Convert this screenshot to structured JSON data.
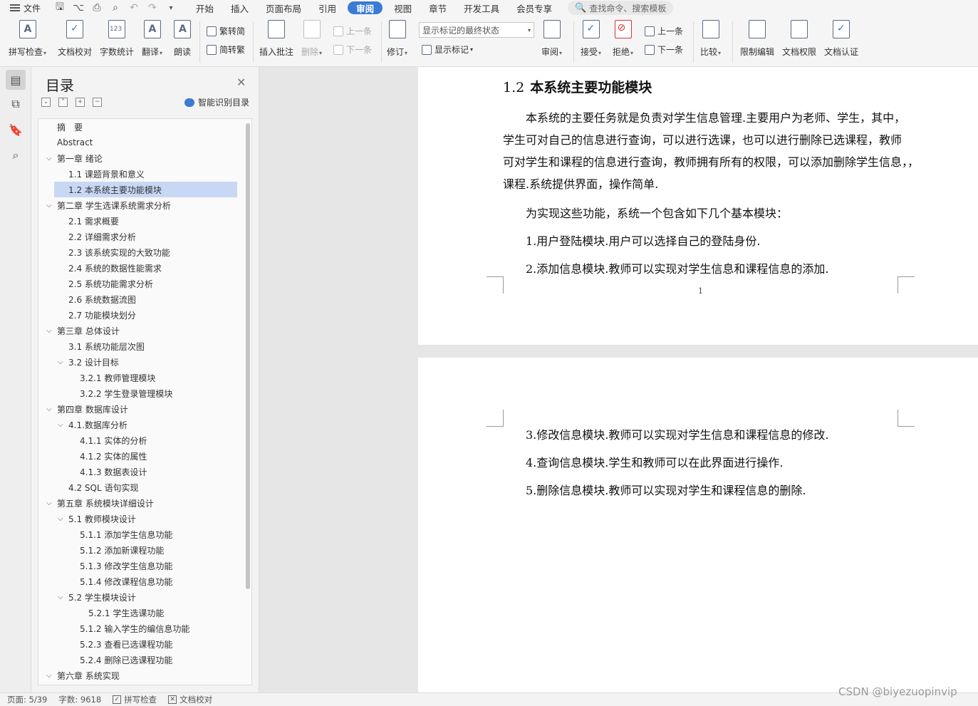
{
  "menubar": {
    "file_label": "文件",
    "tabs": [
      "开始",
      "插入",
      "页面布局",
      "引用",
      "审阅",
      "视图",
      "章节",
      "开发工具",
      "会员专享"
    ],
    "active_tab": "审阅",
    "search_placeholder": "查找命令、搜索模板"
  },
  "ribbon": {
    "spell_check": "拼写检查",
    "doc_proofread": "文档校对",
    "word_count": "字数统计",
    "translate": "翻译",
    "read_aloud": "朗读",
    "trad_to_simp": "繁转简",
    "simp_to_trad": "简转繁",
    "insert_comment": "插入批注",
    "delete": "删除",
    "prev_comment": "上一条",
    "next_comment": "下一条",
    "revise": "修订",
    "markup_status": "显示标记的最终状态",
    "show_markup": "显示标记",
    "review": "审阅",
    "accept": "接受",
    "reject": "拒绝",
    "prev_change": "上一条",
    "next_change": "下一条",
    "compare": "比较",
    "restrict_edit": "限制编辑",
    "doc_permission": "文档权限",
    "doc_certify": "文档认证"
  },
  "toc": {
    "title": "目录",
    "smart_label": "智能识别目录",
    "items": [
      {
        "text": "摘　要",
        "level": 1,
        "chev": false
      },
      {
        "text": "Abstract",
        "level": 1,
        "chev": false
      },
      {
        "text": "第一章  绪论",
        "level": 1,
        "chev": true
      },
      {
        "text": "1.1  课题背景和意义",
        "level": 2,
        "chev": false
      },
      {
        "text": "1.2  本系统主要功能模块",
        "level": 2,
        "chev": false,
        "selected": true
      },
      {
        "text": "第二章  学生选课系统需求分析",
        "level": 1,
        "chev": true
      },
      {
        "text": "2.1 需求概要",
        "level": 2,
        "chev": false
      },
      {
        "text": "2.2 详细需求分析",
        "level": 2,
        "chev": false
      },
      {
        "text": "2.3 该系统实现的大致功能",
        "level": 2,
        "chev": false
      },
      {
        "text": "2.4 系统的数据性能需求",
        "level": 2,
        "chev": false
      },
      {
        "text": "2.5 系统功能需求分析",
        "level": 2,
        "chev": false
      },
      {
        "text": "2.6 系统数据流图",
        "level": 2,
        "chev": false
      },
      {
        "text": "2.7  功能模块划分",
        "level": 2,
        "chev": false
      },
      {
        "text": "第三章    总体设计",
        "level": 1,
        "chev": true
      },
      {
        "text": "3.1 系统功能层次图",
        "level": 2,
        "chev": false
      },
      {
        "text": "3.2 设计目标",
        "level": 2,
        "chev": true
      },
      {
        "text": "3.2.1 教师管理模块",
        "level": 3,
        "chev": false
      },
      {
        "text": "3.2.2 学生登录管理模块",
        "level": 3,
        "chev": false
      },
      {
        "text": "第四章    数据库设计",
        "level": 1,
        "chev": true
      },
      {
        "text": "4.1.数据库分析",
        "level": 2,
        "chev": true
      },
      {
        "text": "4.1.1 实体的分析",
        "level": 3,
        "chev": false
      },
      {
        "text": "4.1.2 实体的属性",
        "level": 3,
        "chev": false
      },
      {
        "text": "4.1.3 数据表设计",
        "level": 3,
        "chev": false
      },
      {
        "text": "4.2 SQL 语句实现",
        "level": 2,
        "chev": false
      },
      {
        "text": "第五章    系统模块详细设计",
        "level": 1,
        "chev": true
      },
      {
        "text": "5.1 教师模块设计",
        "level": 2,
        "chev": true
      },
      {
        "text": "5.1.1 添加学生信息功能",
        "level": 3,
        "chev": false
      },
      {
        "text": "5.1.2 添加新课程功能",
        "level": 3,
        "chev": false
      },
      {
        "text": "5.1.3 修改学生信息功能",
        "level": 3,
        "chev": false
      },
      {
        "text": "5.1.4 修改课程信息功能",
        "level": 3,
        "chev": false
      },
      {
        "text": "5.2 学生模块设计",
        "level": 2,
        "chev": true
      },
      {
        "text": "5.2.1 学生选课功能",
        "level": 4,
        "chev": false
      },
      {
        "text": "5.1.2 输入学生的编信息功能",
        "level": 3,
        "chev": false
      },
      {
        "text": "5.2.3 查看已选课程功能",
        "level": 3,
        "chev": false
      },
      {
        "text": "5.2.4 删除已选课程功能",
        "level": 3,
        "chev": false
      },
      {
        "text": "第六章    系统实现",
        "level": 1,
        "chev": true
      }
    ]
  },
  "document": {
    "heading_num": "1.2",
    "heading_text": "本系统主要功能模块",
    "page1_lines": [
      {
        "text": "本系统的主要任务就是负责对学生信息管理.主要用户为老师、学生，其中，",
        "indent": true
      },
      {
        "text": "学生可对自己的信息进行查询，可以进行选课，也可以进行删除已选课程，教师",
        "indent": false
      },
      {
        "text": "可对学生和课程的信息进行查询，教师拥有所有的权限，可以添加删除学生信息，，",
        "indent": false
      },
      {
        "text": "课程.系统提供界面，操作简单.",
        "indent": false
      },
      {
        "text": "为实现这些功能，系统一个包含如下几个基本模块：",
        "indent": true
      },
      {
        "text": "1.用户登陆模块.用户可以选择自己的登陆身份.",
        "indent": true
      },
      {
        "text": "2.添加信息模块.教师可以实现对学生信息和课程信息的添加.",
        "indent": true
      }
    ],
    "page_number": "1",
    "page2_lines": [
      {
        "text": "3.修改信息模块.教师可以实现对学生信息和课程信息的修改.",
        "indent": true
      },
      {
        "text": "4.查询信息模块.学生和教师可以在此界面进行操作.",
        "indent": true
      },
      {
        "text": "5.删除信息模块.教师可以实现对学生和课程信息的删除.",
        "indent": true
      }
    ]
  },
  "statusbar": {
    "page": "页面: 5/39",
    "words": "字数: 9618",
    "spell_check": "拼写检查",
    "proofread": "文档校对"
  },
  "watermark": "CSDN @biyezuopinvip",
  "colors": {
    "accent": "#3a7bd5",
    "toc_selected": "#c8d8f4"
  }
}
